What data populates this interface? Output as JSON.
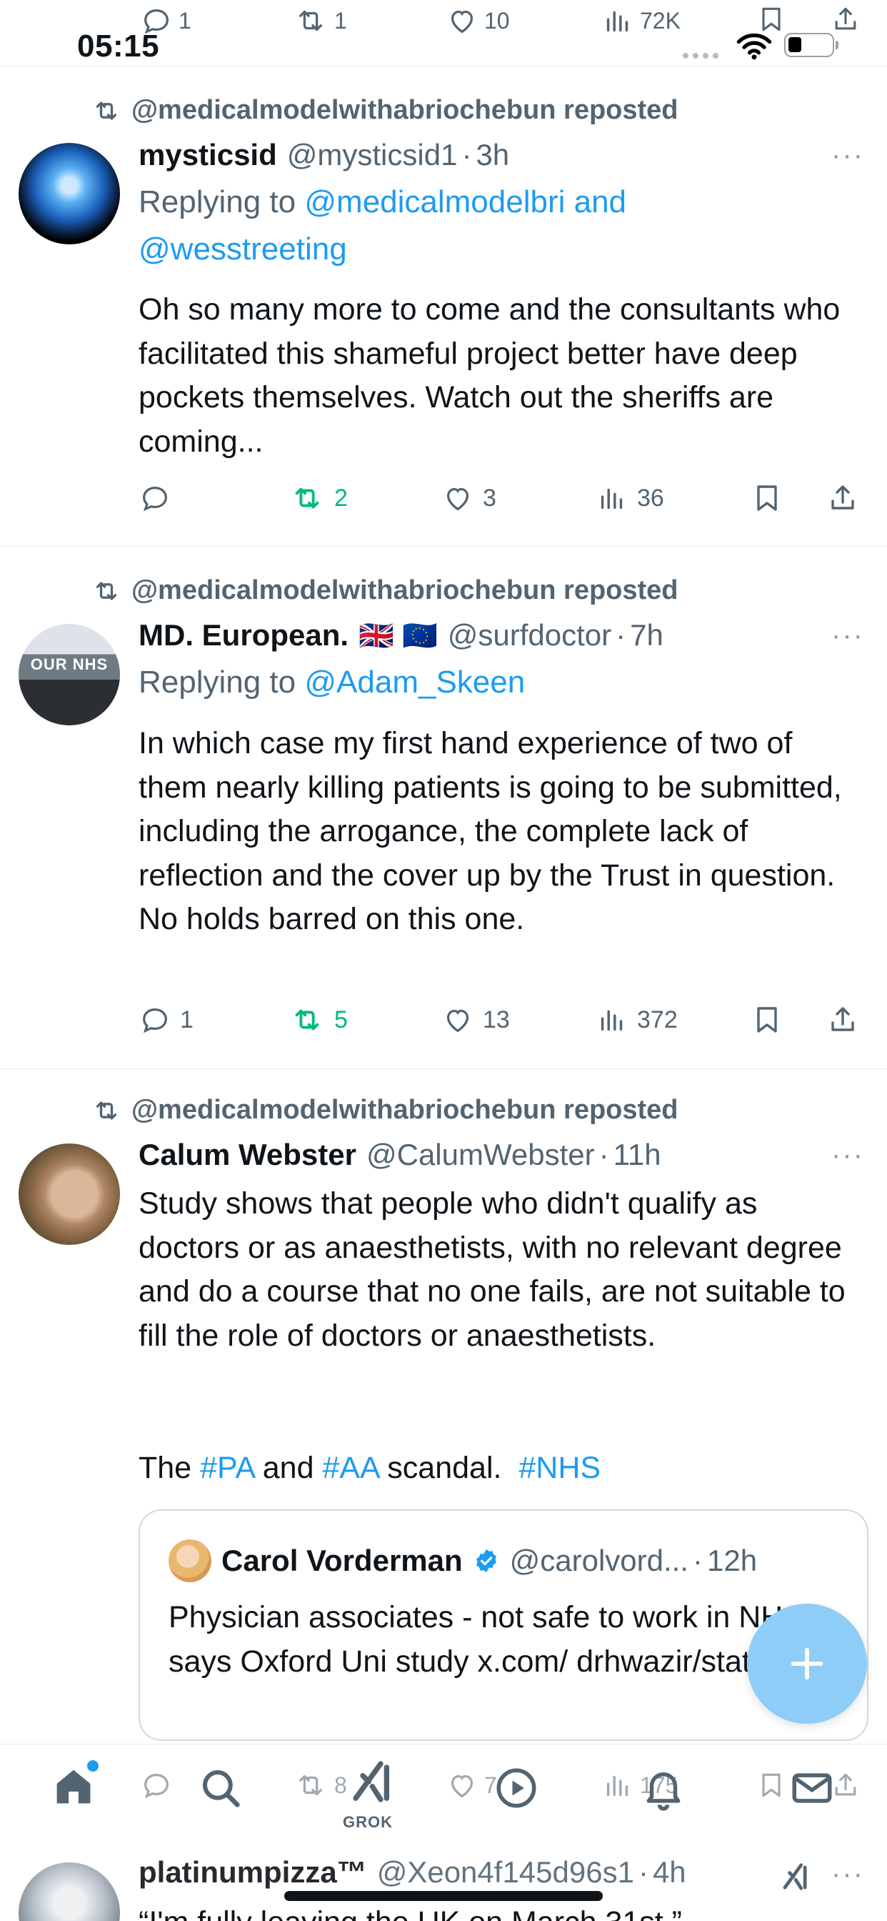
{
  "status_bar": {
    "time": "05:15"
  },
  "top_stats": {
    "replies": "1",
    "reposts": "1",
    "likes": "10",
    "views": "72K"
  },
  "tweets": [
    {
      "reposted_by": "@medicalmodelwithabriochebun reposted",
      "name": "mysticsid",
      "handle": "@mysticsid1",
      "dot": "·",
      "time": "3h",
      "more": "···",
      "replying_prefix": "Replying to",
      "replying_users": "@medicalmodelbri and",
      "replying_users2": "@wesstreeting",
      "text": "Oh so many more to come and the consultants who facilitated this shameful project better have deep pockets themselves. Watch out the sheriffs are coming...",
      "stats": {
        "replies": "",
        "reposts": "2",
        "likes": "3",
        "views": "36"
      }
    },
    {
      "reposted_by": "@medicalmodelwithabriochebun reposted",
      "name": "MD. European.",
      "flags": "🇬🇧 🇪🇺",
      "handle": "@surfdoctor",
      "dot": "·",
      "time": "7h",
      "more": "···",
      "replying_prefix": "Replying to",
      "replying_users": "@Adam_Skeen",
      "avatar_text": "OUR NHS",
      "text": "In which case my first hand experience of two of them nearly killing patients is going to be submitted, including the arrogance, the complete lack of reflection and the cover up by the Trust in question. No holds barred on this one.",
      "stats": {
        "replies": "1",
        "reposts": "5",
        "likes": "13",
        "views": "372"
      }
    },
    {
      "reposted_by": "@medicalmodelwithabriochebun reposted",
      "name": "Calum Webster",
      "handle": "@CalumWebster",
      "dot": "·",
      "time": "11h",
      "more": "···",
      "text": "Study shows that people who didn't qualify as doctors or as anaesthetists, with no relevant degree and do a course that no one fails, are not suitable to fill the role of doctors or anaesthetists.",
      "line2_prefix": "The",
      "tag1": "#PA",
      "and": "and",
      "tag2": "#AA",
      "scandal": "scandal.",
      "tag3": "#NHS",
      "quote": {
        "name": "Carol Vorderman",
        "handle": "@carolvord...",
        "dot": "·",
        "time": "12h",
        "text": "Physician associates - not safe to work in NHS says Oxford Uni study x.com/ drhwazir/statu..."
      }
    }
  ],
  "bottom_nav": {
    "grok_label": "GROK",
    "underlying_stats": {
      "reposts": "8",
      "likes": "7",
      "views": "175"
    }
  },
  "next_tweet": {
    "name": "platinumpizza™",
    "handle": "@Xeon4f145d96s1",
    "dot": "·",
    "time": "4h",
    "more": "···",
    "text_partial": "“I'm fully leaving the UK on March 31st.”"
  },
  "colors": {
    "accent": "#1d9bf0",
    "repost_green": "#00ba7c",
    "secondary": "#536471",
    "fab": "#8ecdf7"
  }
}
